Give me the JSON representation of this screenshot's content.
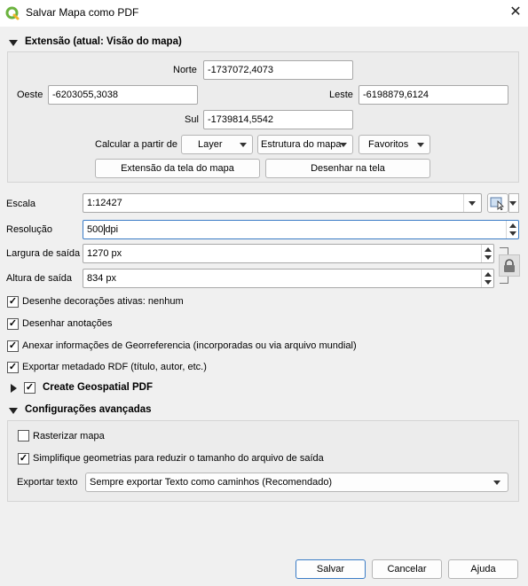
{
  "window": {
    "title": "Salvar Mapa como PDF",
    "close_glyph": "✕"
  },
  "extent": {
    "header": "Extensão (atual: Visão do mapa)",
    "north_label": "Norte",
    "north_value": "-1737072,4073",
    "west_label": "Oeste",
    "west_value": "-6203055,3038",
    "east_label": "Leste",
    "east_value": "-6198879,6124",
    "south_label": "Sul",
    "south_value": "-1739814,5542",
    "calc_label": "Calcular a partir de",
    "layer_btn": "Layer",
    "layout_btn": "Estrutura do mapa",
    "bookmarks_btn": "Favoritos",
    "canvas_extent_btn": "Extensão da tela do mapa",
    "draw_canvas_btn": "Desenhar na tela"
  },
  "scale": {
    "label": "Escala",
    "value": "1:12427"
  },
  "resolution": {
    "label": "Resolução",
    "value": "500",
    "unit": "dpi"
  },
  "width": {
    "label": "Largura de saída",
    "value": "1270 px"
  },
  "height": {
    "label": "Altura de saída",
    "value": "834 px"
  },
  "options": [
    {
      "label": "Desenhe decorações ativas: nenhum",
      "checked": true
    },
    {
      "label": "Desenhar anotações",
      "checked": true
    },
    {
      "label": "Anexar informações de Georreferencia (incorporadas ou via arquivo mundial)",
      "checked": true
    },
    {
      "label": "Exportar metadado RDF (título, autor, etc.)",
      "checked": true
    }
  ],
  "geospatial": {
    "label": "Create Geospatial PDF",
    "checked": true
  },
  "advanced": {
    "header": "Configurações avançadas",
    "rasterize_label": "Rasterizar mapa",
    "rasterize_checked": false,
    "simplify_label": "Simplifique geometrias para reduzir o tamanho do arquivo de saída",
    "simplify_checked": true,
    "export_text_label": "Exportar texto",
    "export_text_value": "Sempre exportar Texto como caminhos (Recomendado)"
  },
  "footer": {
    "save": "Salvar",
    "cancel": "Cancelar",
    "help": "Ajuda"
  },
  "colors": {
    "accent": "#3a7cc6",
    "qgis_green": "#6cb33f"
  },
  "check_glyph": "✓"
}
